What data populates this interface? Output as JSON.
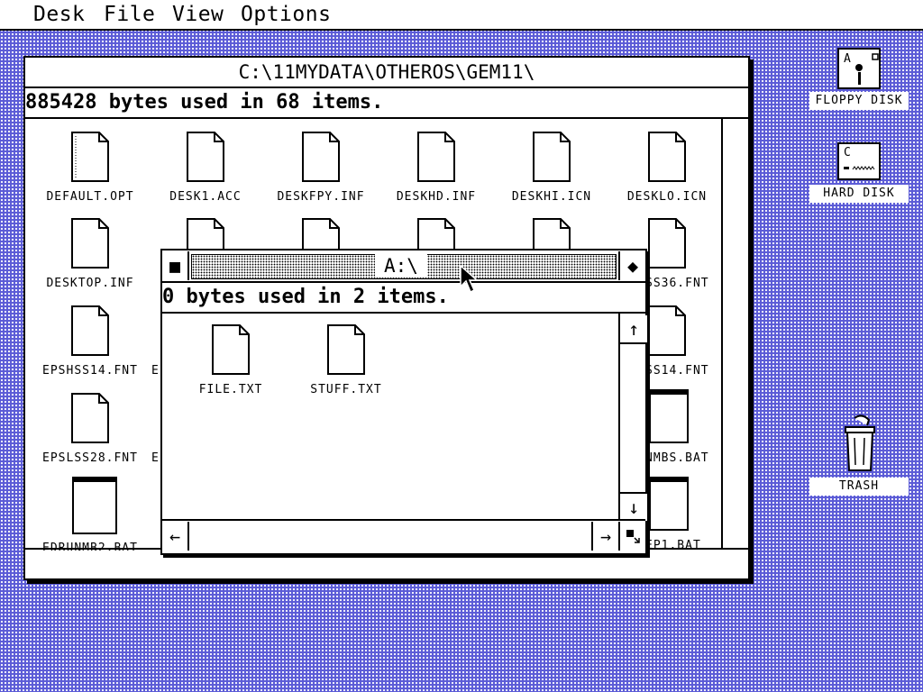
{
  "menubar": {
    "items": [
      "Desk",
      "File",
      "View",
      "Options"
    ]
  },
  "main_window": {
    "title": "C:\\11MYDATA\\OTHEROS\\GEM11\\",
    "info": "885428 bytes used in 68 items.",
    "files": [
      {
        "name": "DEFAULT.OPT",
        "icon": "dotted-document-icon"
      },
      {
        "name": "DESK1.ACC",
        "icon": "document-icon"
      },
      {
        "name": "DESKFPY.INF",
        "icon": "document-icon"
      },
      {
        "name": "DESKHD.INF",
        "icon": "document-icon"
      },
      {
        "name": "DESKHI.ICN",
        "icon": "document-icon"
      },
      {
        "name": "DESKLO.ICN",
        "icon": "document-icon"
      },
      {
        "name": "DESKTOP.INF",
        "icon": "document-icon"
      },
      {
        "name": "EPSHSS14.FNT",
        "icon": "document-icon"
      },
      {
        "name": "EPSLSS28.FNT",
        "icon": "document-icon"
      },
      {
        "name": "EDRUNMB2.BAT",
        "icon": "batch-program-icon"
      }
    ],
    "partial_labels": {
      "row2_right": "SS36.FNT",
      "row3_right": "SS14.FNT",
      "row4_right": "NMBS.BAT",
      "row5_right": "EP1.BAT",
      "row3_left_cut": "E",
      "row4_left_cut": "E",
      "row2_left_cut": "E"
    }
  },
  "floppy_window": {
    "title": "A:\\",
    "info": "0 bytes used in 2 items.",
    "files": [
      {
        "name": "FILE.TXT",
        "icon": "document-icon"
      },
      {
        "name": "STUFF.TXT",
        "icon": "document-icon"
      }
    ],
    "buttons": {
      "close": "■",
      "fuller": "◆",
      "up": "↑",
      "down": "↓",
      "left": "←",
      "right": "→"
    }
  },
  "desktop": {
    "icons": [
      {
        "label": "FLOPPY DISK",
        "drive": "A",
        "icon": "floppy-drive-icon"
      },
      {
        "label": "HARD DISK",
        "drive": "C",
        "icon": "hard-disk-icon"
      },
      {
        "label": "TRASH",
        "icon": "trash-can-icon"
      }
    ]
  },
  "colors": {
    "desktop": "#5b5bd6",
    "window": "#ffffff",
    "ink": "#000000"
  }
}
